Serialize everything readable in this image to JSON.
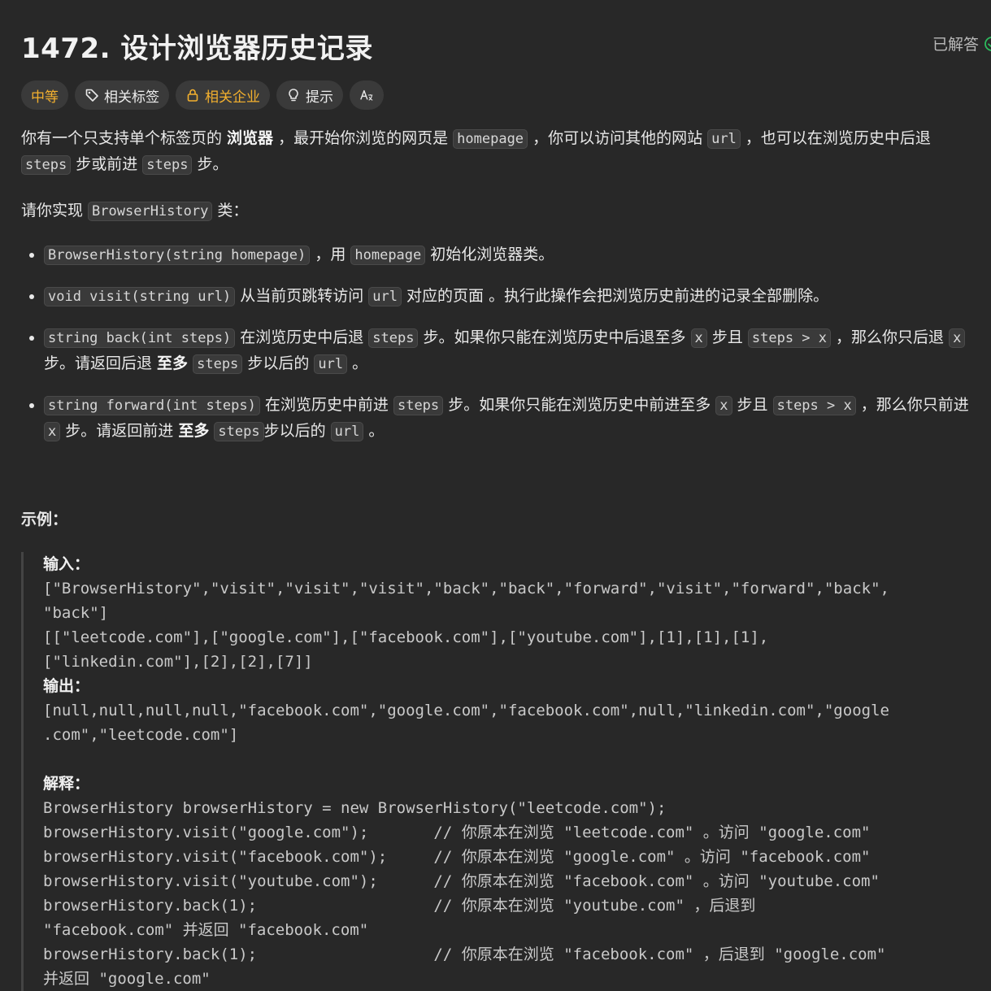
{
  "problem": {
    "title": "1472. 设计浏览器历史记录",
    "status": "已解答"
  },
  "tags": {
    "difficulty": "中等",
    "topics": "相关标签",
    "companies": "相关企业",
    "hint": "提示"
  },
  "desc": {
    "p1_a": "你有一个只支持单个标签页的 ",
    "p1_bold": "浏览器",
    "p1_b": " ，最开始你浏览的网页是 ",
    "p1_code1": "homepage",
    "p1_c": " ，你可以访问其他的网站 ",
    "p1_code2": "url",
    "p1_d": " ，也可以在浏览历史中后退 ",
    "p1_code3": "steps",
    "p1_e": " 步或前进 ",
    "p1_code4": "steps",
    "p1_f": " 步。",
    "p2_a": "请你实现 ",
    "p2_code": "BrowserHistory",
    "p2_b": " 类："
  },
  "methods": [
    {
      "code": "BrowserHistory(string homepage)",
      "t1": " ，用 ",
      "c2": "homepage",
      "t2": " 初始化浏览器类。"
    },
    {
      "code": "void visit(string url)",
      "t1": " 从当前页跳转访问 ",
      "c2": "url",
      "t2": " 对应的页面 。执行此操作会把浏览历史前进的记录全部删除。"
    },
    {
      "code": "string back(int steps)",
      "t1": " 在浏览历史中后退 ",
      "c2": "steps",
      "t2": " 步。如果你只能在浏览历史中后退至多 ",
      "c3": "x",
      "t3": " 步且 ",
      "c4": "steps > x",
      "t4": " ，那么你只后退 ",
      "c5": "x",
      "t5": " 步。请返回后退 ",
      "bold": "至多",
      "t6": " ",
      "c6": "steps",
      "t7": " 步以后的 ",
      "c7": "url",
      "t8": " 。"
    },
    {
      "code": "string forward(int steps)",
      "t1": " 在浏览历史中前进 ",
      "c2": "steps",
      "t2": " 步。如果你只能在浏览历史中前进至多 ",
      "c3": "x",
      "t3": " 步且 ",
      "c4": "steps > x",
      "t4": " ，那么你只前进 ",
      "c5": "x",
      "t5": " 步。请返回前进 ",
      "bold": "至多",
      "t6": " ",
      "c6": "steps",
      "t7": "步以后的 ",
      "c7": "url",
      "t8": " 。"
    }
  ],
  "example": {
    "title": "示例：",
    "input_label": "输入：",
    "input_lines": [
      "[\"BrowserHistory\",\"visit\",\"visit\",\"visit\",\"back\",\"back\",\"forward\",\"visit\",\"forward\",\"back\",",
      "\"back\"]",
      "[[\"leetcode.com\"],[\"google.com\"],[\"facebook.com\"],[\"youtube.com\"],[1],[1],[1],",
      "[\"linkedin.com\"],[2],[2],[7]]"
    ],
    "output_label": "输出：",
    "output_lines": [
      "[null,null,null,null,\"facebook.com\",\"google.com\",\"facebook.com\",null,\"linkedin.com\",\"google",
      ".com\",\"leetcode.com\"]"
    ],
    "explain_label": "解释：",
    "explain_lines": [
      "BrowserHistory browserHistory = new BrowserHistory(\"leetcode.com\");",
      "browserHistory.visit(\"google.com\");       // 你原本在浏览 \"leetcode.com\" 。访问 \"google.com\"",
      "browserHistory.visit(\"facebook.com\");     // 你原本在浏览 \"google.com\" 。访问 \"facebook.com\"",
      "browserHistory.visit(\"youtube.com\");      // 你原本在浏览 \"facebook.com\" 。访问 \"youtube.com\"",
      "browserHistory.back(1);                   // 你原本在浏览 \"youtube.com\" ，后退到",
      "\"facebook.com\" 并返回 \"facebook.com\"",
      "browserHistory.back(1);                   // 你原本在浏览 \"facebook.com\" ，后退到 \"google.com\"",
      "并返回 \"google.com\""
    ]
  }
}
